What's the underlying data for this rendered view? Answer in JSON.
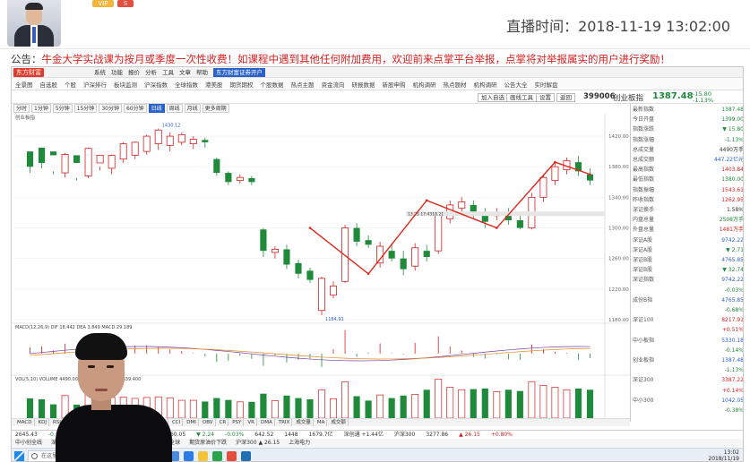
{
  "header": {
    "vip_label": "VIP",
    "s_label": "S",
    "live_time": "直播时间：2018-11-19 13:02:00"
  },
  "announcement": {
    "prefix": "公告：",
    "text": "牛金大学实战课为按月或季度一次性收费！如课程中遇到其他任何附加费用，欢迎前来点掌平台举报，点掌将对举报属实的用户进行奖励！"
  },
  "app": {
    "logo": "东方财富",
    "menu": [
      "系统",
      "功能",
      "报价",
      "分析",
      "工具",
      "文章",
      "帮助"
    ],
    "menu_highlight": "东方财富证券开户",
    "toolbar": [
      "全景图",
      "自选股",
      "个股",
      "沪深排行",
      "板块监测",
      "沪深指数",
      "全球指数",
      "港美股",
      "期货期权",
      "个股数据",
      "热点主题",
      "资金流向",
      "研报数据",
      "新股申购",
      "机构调研",
      "热点题材",
      "机构调研",
      "公告大全",
      "实时解盘"
    ],
    "sub_buttons": [
      "加入自选",
      "画线工具",
      "设置",
      "返回"
    ],
    "stock_code": "399006",
    "stock_name": "创业板指",
    "stock_price": "1387.48",
    "stock_change": "-15.80",
    "stock_change_pct": "-1.13%",
    "periods": [
      "分时",
      "1分钟",
      "5分钟",
      "15分钟",
      "30分钟",
      "60分钟",
      "日线",
      "周线",
      "月线",
      "更多周期"
    ],
    "active_period": "日线",
    "chart_label": "创业板指",
    "chart_high_label": "1430.12",
    "chart_low_label": "1184.91",
    "price_ticks": [
      "1460.00",
      "1420.00",
      "1380.00",
      "1340.00",
      "1300.00",
      "1260.00",
      "1220.00",
      "1180.00"
    ],
    "crosshair_label": "13.25 17:4318.21",
    "macd_label": "MACD(12,26,9) DIF 18.442 DEA 3.849 MACD 29.189",
    "vol_label": "VOL(5,10) VOLUME 4490.00万手 MAVOL5 41212839.400",
    "indicators": [
      "MACD",
      "KDJ",
      "RSI",
      "BOLL",
      "WR",
      "DMA",
      "BIAS",
      "ENE",
      "BBAR",
      "CCI",
      "DMI",
      "OBV",
      "CR",
      "PSY",
      "VR",
      "DMA",
      "TRIX",
      "成交量",
      "MA",
      "成交额"
    ],
    "right_panel": [
      {
        "k": "最新指数",
        "v": "1387.48",
        "c": "green"
      },
      {
        "k": "今日开盘",
        "v": "1399.00",
        "c": "green"
      },
      {
        "k": "指数涨跌",
        "v": "▼ 15.80",
        "c": "green"
      },
      {
        "k": "指数涨幅",
        "v": "-1.13%",
        "c": "green"
      },
      {
        "k": "总成交量",
        "v": "4490万手",
        "c": ""
      },
      {
        "k": "总成交额",
        "v": "447.22亿元",
        "c": "blue"
      },
      {
        "k": "最高指数",
        "v": "1403.84",
        "c": "red"
      },
      {
        "k": "最低指数",
        "v": "1380.00",
        "c": "green"
      },
      {
        "k": "指数振幅",
        "v": "1543.61",
        "c": "red"
      },
      {
        "k": "昨收指数",
        "v": "1262.95",
        "c": "red"
      },
      {
        "k": "深证换手",
        "v": "1.58%",
        "c": ""
      },
      {
        "k": "内盘总量",
        "v": "2508万手",
        "c": "green"
      },
      {
        "k": "外盘总量",
        "v": "1481万手",
        "c": "red"
      },
      {
        "k": "深证A股",
        "v": "9742.22",
        "c": "blue"
      },
      {
        "k": "深证A股",
        "v": "▼ 2.71",
        "c": "green"
      },
      {
        "k": "深证B股",
        "v": "4765.85",
        "c": "blue"
      },
      {
        "k": "深证B股",
        "v": "▼ 32.74",
        "c": "green"
      },
      {
        "k": "深证指数",
        "v": "9742.22",
        "c": "blue"
      },
      {
        "k": "",
        "v": "-0.03%",
        "c": "green"
      },
      {
        "k": "成份B指",
        "v": "4765.85",
        "c": "blue"
      },
      {
        "k": "",
        "v": "-0.68%",
        "c": "green"
      },
      {
        "k": "深证100",
        "v": "8217.91",
        "c": "red"
      },
      {
        "k": "",
        "v": "+0.51%",
        "c": "red"
      },
      {
        "k": "中小板指",
        "v": "5330.18",
        "c": "blue"
      },
      {
        "k": "",
        "v": "-0.14%",
        "c": "green"
      },
      {
        "k": "创业板指",
        "v": "1387.48",
        "c": "blue"
      },
      {
        "k": "",
        "v": "-1.13%",
        "c": "green"
      },
      {
        "k": "深证300",
        "v": "3387.22",
        "c": "red"
      },
      {
        "k": "",
        "v": "+0.14%",
        "c": "red"
      },
      {
        "k": "中小300",
        "v": "1042.05",
        "c": "blue"
      },
      {
        "k": "",
        "v": "-0.38%",
        "c": "green"
      }
    ],
    "status_items": [
      "2645.43",
      "-0.11%",
      "1356.0亿",
      "沪创通 +5.97亿",
      "9860.05",
      "▼ 2.24",
      "-0.03%",
      "642.52",
      "1448",
      "1679.7亿",
      "深创通 +1.44亿",
      "沪深300",
      "3277.86",
      "▲ 26.15",
      "+0.80%"
    ],
    "status_items2": [
      "中小创全线",
      "深证板块",
      "全国股市",
      "中国证监会公告",
      "宁光全球",
      "期货原油价下跌",
      "沪深300 ▲ 26.15",
      "上海电力"
    ],
    "search_placeholder": "在这里输入你要搜索的内容",
    "clock_time": "13:02",
    "clock_date": "2018/11/19"
  },
  "chart_data": {
    "type": "candlestick",
    "candles": [
      [
        1380,
        1400,
        1395,
        1372,
        "g"
      ],
      [
        1385,
        1405,
        1398,
        1378,
        "g"
      ],
      [
        1395,
        1400,
        1374,
        1370,
        "g"
      ],
      [
        1372,
        1396,
        1398,
        1366,
        "r"
      ],
      [
        1385,
        1395,
        1365,
        1362,
        "g"
      ],
      [
        1368,
        1404,
        1405,
        1365,
        "r"
      ],
      [
        1385,
        1395,
        1380,
        1375,
        "r"
      ],
      [
        1378,
        1395,
        1396,
        1370,
        "r"
      ],
      [
        1390,
        1410,
        1412,
        1385,
        "r"
      ],
      [
        1395,
        1412,
        1413,
        1390,
        "r"
      ],
      [
        1400,
        1420,
        1422,
        1396,
        "r"
      ],
      [
        1410,
        1428,
        1430,
        1402,
        "r"
      ],
      [
        1408,
        1420,
        1425,
        1400,
        "r"
      ],
      [
        1412,
        1422,
        1425,
        1408,
        "r"
      ],
      [
        1410,
        1416,
        1420,
        1403,
        "r"
      ],
      [
        1415,
        1412,
        1418,
        1405,
        "g"
      ],
      [
        1390,
        1372,
        1392,
        1368,
        "g"
      ],
      [
        1372,
        1360,
        1374,
        1356,
        "g"
      ],
      [
        1362,
        1366,
        1370,
        1358,
        "r"
      ],
      [
        1365,
        1360,
        1368,
        1356,
        "g"
      ],
      [
        1298,
        1270,
        1300,
        1262,
        "g"
      ],
      [
        1268,
        1272,
        1276,
        1260,
        "r"
      ],
      [
        1272,
        1252,
        1278,
        1246,
        "g"
      ],
      [
        1254,
        1240,
        1258,
        1234,
        "g"
      ],
      [
        1244,
        1232,
        1248,
        1228,
        "g"
      ],
      [
        1234,
        1192,
        1236,
        1186,
        "r"
      ],
      [
        1212,
        1224,
        1230,
        1208,
        "r"
      ],
      [
        1230,
        1300,
        1304,
        1228,
        "r"
      ],
      [
        1300,
        1282,
        1306,
        1276,
        "g"
      ],
      [
        1284,
        1278,
        1290,
        1274,
        "g"
      ],
      [
        1254,
        1276,
        1282,
        1248,
        "r"
      ],
      [
        1270,
        1260,
        1280,
        1256,
        "g"
      ],
      [
        1260,
        1246,
        1270,
        1238,
        "g"
      ],
      [
        1250,
        1274,
        1280,
        1244,
        "r"
      ],
      [
        1270,
        1262,
        1278,
        1256,
        "g"
      ],
      [
        1270,
        1318,
        1322,
        1266,
        "r"
      ],
      [
        1312,
        1330,
        1336,
        1306,
        "r"
      ],
      [
        1326,
        1334,
        1340,
        1318,
        "r"
      ],
      [
        1330,
        1320,
        1336,
        1312,
        "g"
      ],
      [
        1320,
        1308,
        1326,
        1300,
        "g"
      ],
      [
        1316,
        1320,
        1326,
        1310,
        "r"
      ],
      [
        1320,
        1310,
        1326,
        1304,
        "g"
      ],
      [
        1310,
        1300,
        1316,
        1298,
        "g"
      ],
      [
        1300,
        1340,
        1346,
        1298,
        "r"
      ],
      [
        1340,
        1366,
        1370,
        1334,
        "r"
      ],
      [
        1362,
        1380,
        1386,
        1356,
        "r"
      ],
      [
        1376,
        1388,
        1392,
        1370,
        "r"
      ],
      [
        1386,
        1374,
        1394,
        1368,
        "g"
      ],
      [
        1370,
        1362,
        1378,
        1356,
        "g"
      ]
    ],
    "trend_line": [
      [
        24,
        1300
      ],
      [
        29,
        1240
      ],
      [
        34,
        1336
      ],
      [
        40,
        1300
      ],
      [
        45,
        1386
      ],
      [
        48,
        1370
      ]
    ],
    "ylim": [
      1180,
      1440
    ],
    "high_label": "1430.12",
    "low_label": "1184.91"
  },
  "colors": {
    "up": "#d62020",
    "down": "#1f8b3a",
    "accent": "#2a62c9",
    "trend": "#e0261b"
  }
}
